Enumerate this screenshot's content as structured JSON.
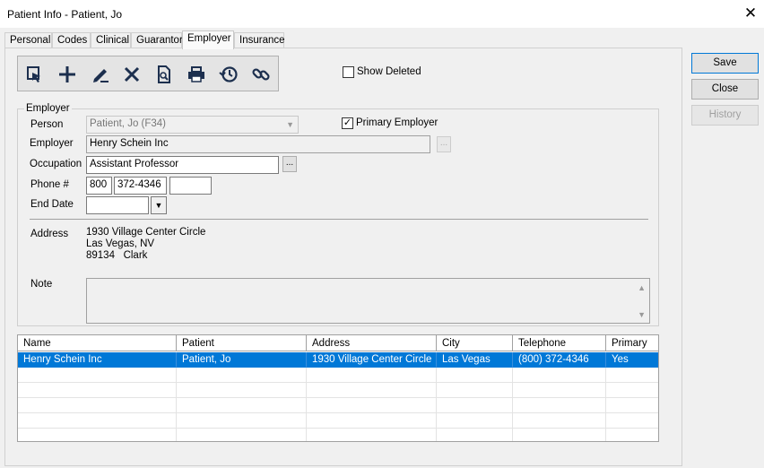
{
  "window": {
    "title": "Patient Info - Patient, Jo",
    "close_glyph": "✕"
  },
  "tabs": [
    {
      "label": "Personal"
    },
    {
      "label": "Codes"
    },
    {
      "label": "Clinical"
    },
    {
      "label": "Guarantor"
    },
    {
      "label": "Employer",
      "active": true
    },
    {
      "label": "Insurance"
    }
  ],
  "toolbar": {
    "buttons": [
      "select-employer-icon",
      "add-icon",
      "edit-icon",
      "delete-icon",
      "preview-icon",
      "print-icon",
      "history-icon",
      "link-icon"
    ]
  },
  "show_deleted": {
    "label": "Show Deleted",
    "checked": false
  },
  "employer_group": {
    "legend": "Employer",
    "person_label": "Person",
    "person_value": "Patient, Jo (F34)",
    "primary_employer_label": "Primary Employer",
    "primary_employer_checked": true,
    "employer_label": "Employer",
    "employer_value": "Henry Schein Inc",
    "occupation_label": "Occupation",
    "occupation_value": "Assistant Professor",
    "phone_label": "Phone #",
    "phone_area": "800",
    "phone_number": "372-4346",
    "phone_ext": "",
    "end_date_label": "End Date",
    "end_date_value": "",
    "address_label": "Address",
    "address_line1": "1930 Village Center Circle",
    "address_line2": "Las Vegas, NV",
    "address_line3": "89134   Clark",
    "note_label": "Note",
    "note_value": "",
    "ellipsis": "..."
  },
  "grid": {
    "columns": [
      "Name",
      "Patient",
      "Address",
      "City",
      "Telephone",
      "Primary"
    ],
    "rows": [
      {
        "name": "Henry Schein Inc",
        "patient": "Patient, Jo",
        "address": "1930 Village Center Circle",
        "city": "Las Vegas",
        "telephone": "(800) 372-4346",
        "primary": "Yes",
        "selected": true
      }
    ]
  },
  "side_buttons": {
    "save": "Save",
    "close": "Close",
    "history": "History"
  },
  "colors": {
    "selection": "#0078d7",
    "background": "#f0f0f0"
  }
}
